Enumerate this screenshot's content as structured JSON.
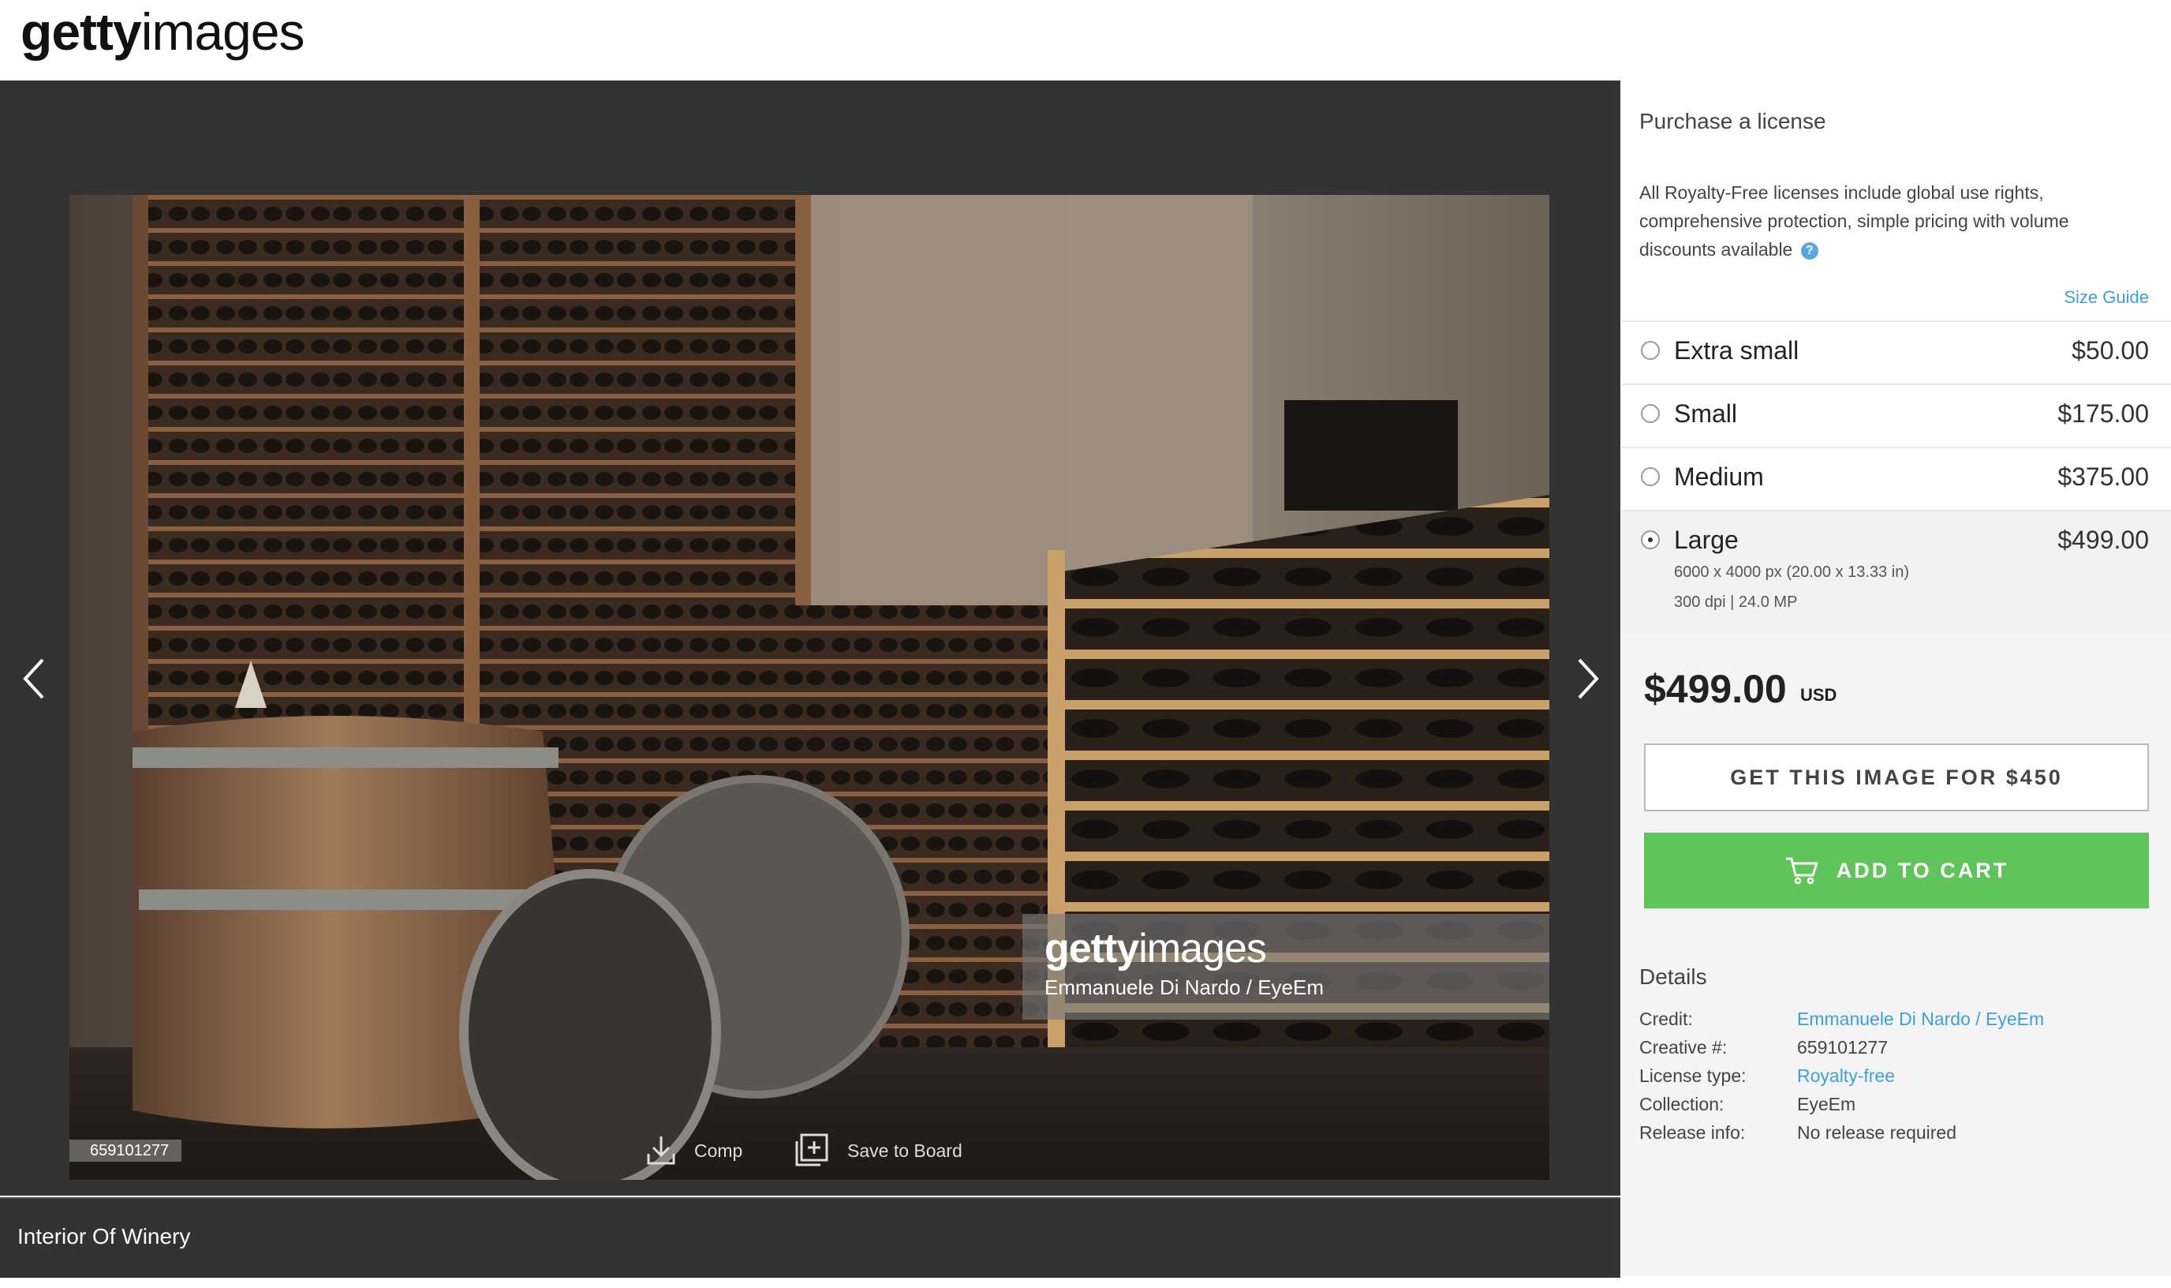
{
  "brand": {
    "logo_bold": "getty",
    "logo_light": "images"
  },
  "image": {
    "watermark_logo_bold": "getty",
    "watermark_logo_light": "images",
    "watermark_credit": "Emmanuele Di Nardo / EyeEm",
    "id_tag": "659101277",
    "title": "Interior Of Winery"
  },
  "actions": {
    "comp_label": "Comp",
    "save_label": "Save to Board"
  },
  "purchase": {
    "title": "Purchase a license",
    "description": "All Royalty-Free licenses include global use rights, comprehensive protection, simple pricing with volume discounts available",
    "help_glyph": "?",
    "size_guide": "Size Guide",
    "sizes": [
      {
        "name": "Extra small",
        "price": "$50.00"
      },
      {
        "name": "Small",
        "price": "$175.00"
      },
      {
        "name": "Medium",
        "price": "$375.00"
      },
      {
        "name": "Large",
        "price": "$499.00",
        "spec1": "6000 x 4000 px (20.00 x 13.33 in)",
        "spec2": "300 dpi | 24.0 MP"
      }
    ],
    "selected": "Large",
    "total": "$499.00",
    "currency": "USD",
    "get_button": "GET THIS IMAGE FOR $450",
    "cart_button": "ADD TO CART"
  },
  "details": {
    "title": "Details",
    "rows": [
      {
        "key": "Credit:",
        "value": "Emmanuele Di Nardo / EyeEm"
      },
      {
        "key": "Creative #:",
        "value": "659101277"
      },
      {
        "key": "License type:",
        "value": "Royalty-free"
      },
      {
        "key": "Collection:",
        "value": "EyeEm"
      },
      {
        "key": "Release info:",
        "value": "No release required"
      }
    ]
  },
  "colors": {
    "accent_link": "#3d9fe0",
    "cart_green": "#5fc55b",
    "stage_bg": "#333333"
  },
  "icons": [
    "arrow-left-icon",
    "arrow-right-icon",
    "download-icon",
    "add-to-board-icon",
    "cart-icon",
    "help-icon"
  ]
}
